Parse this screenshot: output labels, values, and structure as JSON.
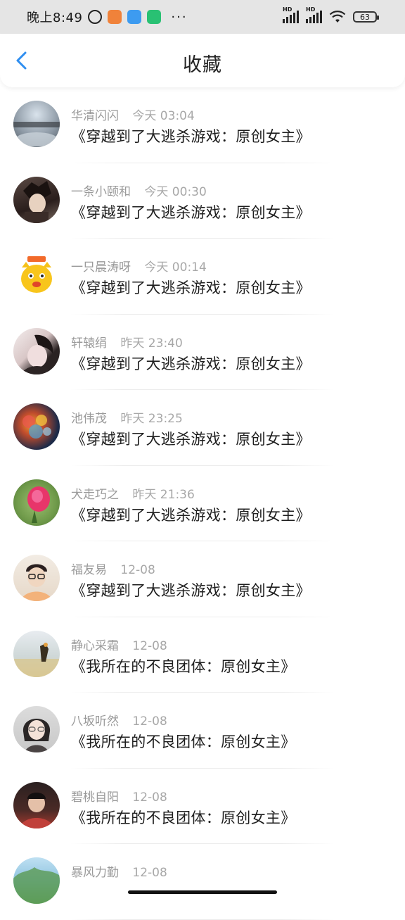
{
  "status_bar": {
    "time": "晚上8:49",
    "dots": "···",
    "battery": "63",
    "hd_label": "HD"
  },
  "header": {
    "title": "收藏"
  },
  "items": [
    {
      "name": "华清闪闪",
      "time": "今天 03:04",
      "title": "《穿越到了大逃杀游戏：原创女主》"
    },
    {
      "name": "一条小颐和",
      "time": "今天 00:30",
      "title": "《穿越到了大逃杀游戏：原创女主》"
    },
    {
      "name": "一只晨涛呀",
      "time": "今天 00:14",
      "title": "《穿越到了大逃杀游戏：原创女主》"
    },
    {
      "name": "轩辕绢",
      "time": "昨天 23:40",
      "title": "《穿越到了大逃杀游戏：原创女主》"
    },
    {
      "name": "池伟茂",
      "time": "昨天 23:25",
      "title": "《穿越到了大逃杀游戏：原创女主》"
    },
    {
      "name": "犬走巧之",
      "time": "昨天 21:36",
      "title": "《穿越到了大逃杀游戏：原创女主》"
    },
    {
      "name": "福友易",
      "time": "12-08",
      "title": "《穿越到了大逃杀游戏：原创女主》"
    },
    {
      "name": "静心采霜",
      "time": "12-08",
      "title": "《我所在的不良团体：原创女主》"
    },
    {
      "name": "八坂听然",
      "time": "12-08",
      "title": "《我所在的不良团体：原创女主》"
    },
    {
      "name": "碧桃自阳",
      "time": "12-08",
      "title": "《我所在的不良团体：原创女主》"
    },
    {
      "name": "暴风力勤",
      "time": "12-08",
      "title": ""
    }
  ],
  "colors": {
    "accent": "#2f8ef0",
    "status_bg": "#e5e5e5",
    "meta_text": "#9a9a9a",
    "title_text": "#1e1e1e"
  }
}
